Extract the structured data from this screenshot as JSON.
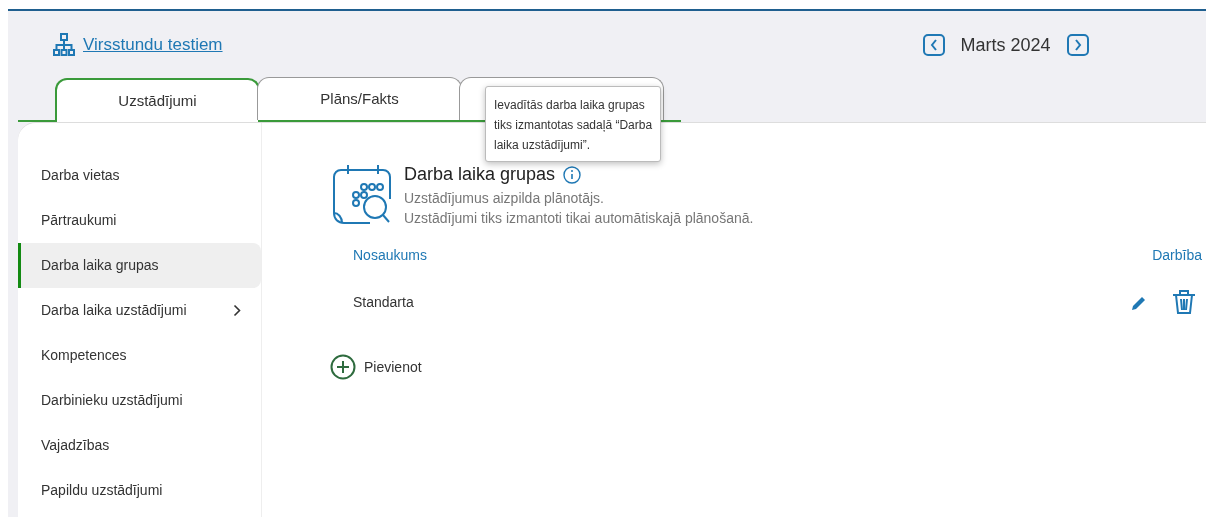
{
  "header": {
    "link": "Virsstundu testiem",
    "period": "Marts 2024"
  },
  "tabs": [
    {
      "label": "Uzstādījumi",
      "selected": true
    },
    {
      "label": "Plāns/Fakts",
      "selected": false
    },
    {
      "selected": false
    }
  ],
  "tooltip": "Ievadītās darba laika grupas tiks izmantotas sadaļā “Darba laika uzstādījumi”.",
  "sidebar": {
    "items": [
      {
        "label": "Darba vietas",
        "selected": false,
        "expandable": false
      },
      {
        "label": "Pārtraukumi",
        "selected": false,
        "expandable": false
      },
      {
        "label": "Darba laika grupas",
        "selected": true,
        "expandable": false
      },
      {
        "label": "Darba laika uzstādījumi",
        "selected": false,
        "expandable": true
      },
      {
        "label": "Kompetences",
        "selected": false,
        "expandable": false
      },
      {
        "label": "Darbinieku uzstādījumi",
        "selected": false,
        "expandable": false
      },
      {
        "label": "Vajadzības",
        "selected": false,
        "expandable": false
      },
      {
        "label": "Papildu uzstādījumi",
        "selected": false,
        "expandable": false
      }
    ]
  },
  "section": {
    "title": "Darba laika grupas",
    "subtitles": [
      "Uzstādījumus aizpilda plānotājs.",
      "Uzstādījumi tiks izmantoti tikai automātiskajā plānošanā."
    ]
  },
  "table": {
    "columns": [
      "Nosaukums",
      "Darbība"
    ],
    "rows": [
      {
        "name": "Standarta"
      }
    ]
  },
  "add_button": "Pievienot"
}
